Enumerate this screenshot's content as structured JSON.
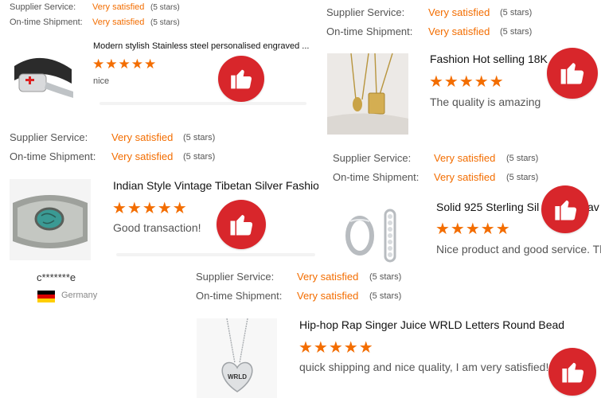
{
  "colors": {
    "accent": "#f36d00",
    "thumb_badge": "#d8262b"
  },
  "labels": {
    "supplier_service": "Supplier Service:",
    "on_time_shipment": "On-time Shipment:",
    "rating_value": "Very satisfied",
    "rating_stars": "(5 stars)"
  },
  "stars_glyph": "★★★★★",
  "reviews": [
    {
      "title": "Modern stylish Stainless steel personalised engraved ...",
      "text": "nice",
      "star_rating": 5,
      "image_icon": "engraved-bracelet"
    },
    {
      "title": "Fashion Hot selling 18K",
      "text": "The quality is amazing",
      "star_rating": 5,
      "image_icon": "gold-pendant-necklace"
    },
    {
      "title": "Indian Style Vintage Tibetan Silver Fashion",
      "text": "Good transaction!",
      "star_rating": 5,
      "image_icon": "turquoise-cuff"
    },
    {
      "title": "Solid 925 Sterling Sil",
      "title_tail": "av",
      "text": "Nice product and good service. Th",
      "star_rating": 5,
      "image_icon": "hoop-earrings"
    },
    {
      "title": "Hip-hop Rap Singer Juice WRLD Letters Round Bead",
      "text": "quick shipping and nice quality, I am very satisfied!",
      "star_rating": 5,
      "image_icon": "heart-pendant",
      "pendant_text": "WRLD"
    }
  ],
  "reviewer": {
    "name": "c*******e",
    "country": "Germany",
    "flag_icon": "germany-flag-icon"
  }
}
